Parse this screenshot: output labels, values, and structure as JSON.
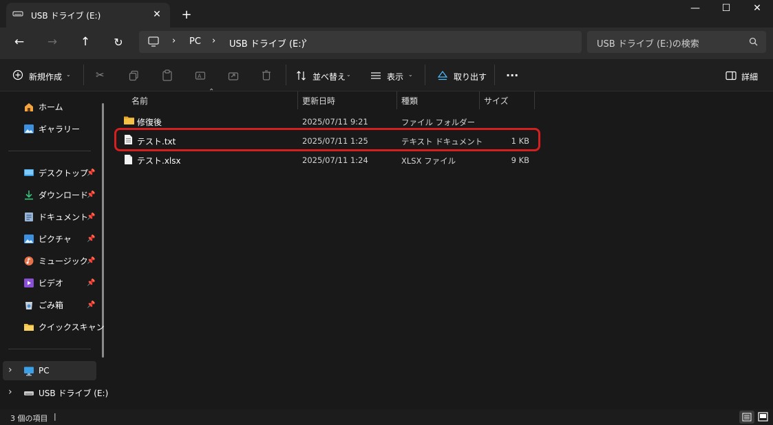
{
  "window": {
    "tab_title": "USB ドライブ (E:)",
    "new_tab": "+",
    "minimize": "—",
    "maximize": "☐",
    "close": "✕"
  },
  "nav": {
    "breadcrumb": [
      "PC",
      "USB ドライブ (E:)"
    ],
    "search_placeholder": "USB ドライブ (E:)の検索"
  },
  "toolbar": {
    "new_label": "新規作成",
    "sort_label": "並べ替え",
    "view_label": "表示",
    "eject_label": "取り出す",
    "more_label": "···",
    "details_label": "詳細"
  },
  "sidebar": {
    "quick": [
      {
        "label": "ホーム",
        "icon": "home-icon"
      },
      {
        "label": "ギャラリー",
        "icon": "gallery-icon"
      }
    ],
    "pinned": [
      {
        "label": "デスクトップ",
        "icon": "desktop-icon"
      },
      {
        "label": "ダウンロード",
        "icon": "download-icon"
      },
      {
        "label": "ドキュメント",
        "icon": "documents-icon"
      },
      {
        "label": "ピクチャ",
        "icon": "pictures-icon"
      },
      {
        "label": "ミュージック",
        "icon": "music-icon"
      },
      {
        "label": "ビデオ",
        "icon": "video-icon"
      },
      {
        "label": "ごみ箱",
        "icon": "recycle-bin-icon"
      },
      {
        "label": "クイックスキャン",
        "icon": "folder-icon"
      }
    ],
    "tree": [
      {
        "label": "PC",
        "icon": "pc-icon"
      },
      {
        "label": "USB ドライブ (E:)",
        "icon": "drive-icon"
      }
    ]
  },
  "columns": {
    "name": "名前",
    "date": "更新日時",
    "type": "種類",
    "size": "サイズ"
  },
  "files": [
    {
      "name": "修復後",
      "date": "2025/07/11 9:21",
      "type": "ファイル フォルダー",
      "size": "",
      "icon": "folder-icon"
    },
    {
      "name": "テスト.txt",
      "date": "2025/07/11 1:25",
      "type": "テキスト ドキュメント",
      "size": "1 KB",
      "icon": "text-file-icon"
    },
    {
      "name": "テスト.xlsx",
      "date": "2025/07/11 1:24",
      "type": "XLSX ファイル",
      "size": "9 KB",
      "icon": "file-icon"
    }
  ],
  "status": {
    "item_count": "3 個の項目",
    "cursor": "|"
  },
  "colors": {
    "highlight_border": "#d42020",
    "folder": "#f4c144",
    "accent": "#4cc2ff"
  }
}
